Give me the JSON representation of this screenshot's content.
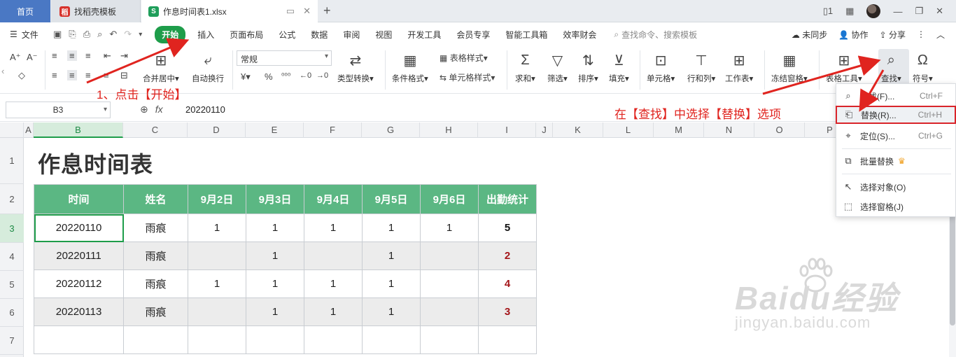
{
  "tabs": {
    "home": "首页",
    "template": "找稻壳模板",
    "file": "作息时间表1.xlsx"
  },
  "menubar": {
    "file": "文件",
    "tabs": [
      "开始",
      "插入",
      "页面布局",
      "公式",
      "数据",
      "审阅",
      "视图",
      "开发工具",
      "会员专享",
      "智能工具箱",
      "效率财会"
    ],
    "active_tab": "开始",
    "search_placeholder": "查找命令、搜索模板",
    "right": [
      "未同步",
      "协作",
      "分享"
    ]
  },
  "ribbon": {
    "number_format": "常规",
    "merge": "合并居中",
    "wrap": "自动换行",
    "convert": "类型转换",
    "cond_format": "条件格式",
    "table_style": "表格样式",
    "cell_style": "单元格样式",
    "sum": "求和",
    "filter": "筛选",
    "sort": "排序",
    "fill": "填充",
    "cell": "单元格",
    "rowcol": "行和列",
    "worksheet": "工作表",
    "freeze": "冻结窗格",
    "table_tools": "表格工具",
    "find": "查找",
    "symbol": "符号"
  },
  "formula": {
    "name_box": "B3",
    "value": "20220110"
  },
  "columns": [
    "A",
    "B",
    "C",
    "D",
    "E",
    "F",
    "G",
    "H",
    "I",
    "J",
    "K",
    "L",
    "M",
    "N",
    "O",
    "P"
  ],
  "rows": [
    "1",
    "2",
    "3",
    "4",
    "5",
    "6",
    "7"
  ],
  "sheet": {
    "title": "作息时间表",
    "headers": [
      "时间",
      "姓名",
      "9月2日",
      "9月3日",
      "9月4日",
      "9月5日",
      "9月6日",
      "出勤统计"
    ],
    "rows": [
      [
        "20220110",
        "雨痕",
        "1",
        "1",
        "1",
        "1",
        "1",
        "5"
      ],
      [
        "20220111",
        "雨痕",
        "",
        "1",
        "",
        "1",
        "",
        "2"
      ],
      [
        "20220112",
        "雨痕",
        "1",
        "1",
        "1",
        "1",
        "",
        "4"
      ],
      [
        "20220113",
        "雨痕",
        "",
        "1",
        "1",
        "1",
        "",
        "3"
      ]
    ]
  },
  "dropdown": {
    "items": [
      {
        "label": "查找(F)...",
        "key": "Ctrl+F"
      },
      {
        "label": "替换(R)...",
        "key": "Ctrl+H"
      },
      {
        "label": "定位(S)...",
        "key": "Ctrl+G"
      },
      {
        "label": "批量替换",
        "key": ""
      },
      {
        "label": "选择对象(O)",
        "key": ""
      },
      {
        "label": "选择窗格(J)",
        "key": ""
      }
    ]
  },
  "annotations": {
    "step1": "1、点击【开始】",
    "step2": "在【查找】中选择【替换】选项"
  },
  "watermark": {
    "logo": "Baidu经验",
    "url": "jingyan.baidu.com"
  },
  "colors": {
    "accent": "#1e9d4a",
    "header_fill": "#5bb783",
    "annotation": "#e0241f"
  }
}
